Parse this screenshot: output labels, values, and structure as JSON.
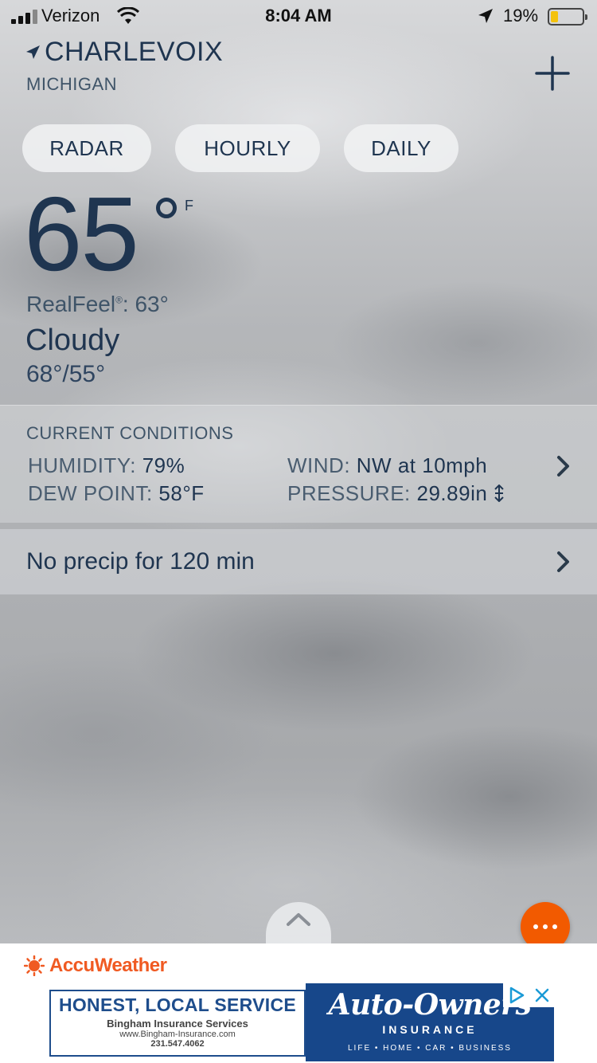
{
  "status_bar": {
    "carrier": "Verizon",
    "time": "8:04 AM",
    "battery_percent": "19%",
    "battery_level": 0.19
  },
  "location": {
    "city": "CHARLEVOIX",
    "state": "MICHIGAN"
  },
  "tabs": [
    {
      "label": "RADAR"
    },
    {
      "label": "HOURLY"
    },
    {
      "label": "DAILY"
    }
  ],
  "current": {
    "temperature": "65",
    "unit": "F",
    "realfeel_label": "RealFeel",
    "realfeel_mark": "®",
    "realfeel_value": ": 63°",
    "phrase": "Cloudy",
    "hi_lo": "68°/55°"
  },
  "conditions": {
    "title": "CURRENT CONDITIONS",
    "humidity_label": "HUMIDITY:",
    "humidity_value": "79%",
    "dew_point_label": "DEW POINT:",
    "dew_point_value": "58°F",
    "wind_label": "WIND:",
    "wind_value": "NW at 10mph",
    "pressure_label": "PRESSURE:",
    "pressure_value": "29.89in"
  },
  "precip": {
    "text": "No precip for 120 min"
  },
  "footer": {
    "brand": "AccuWeather"
  },
  "ad": {
    "headline": "HONEST, LOCAL SERVICE",
    "company": "Bingham Insurance Services",
    "website": "www.Bingham-Insurance.com",
    "phone": "231.547.4062",
    "brand": "Auto-Owners",
    "brand_sub": "INSURANCE",
    "tagline": "LIFE • HOME • CAR • BUSINESS"
  },
  "colors": {
    "accent": "#f25a00",
    "text": "#1f3550",
    "ad_blue": "#17478a"
  }
}
